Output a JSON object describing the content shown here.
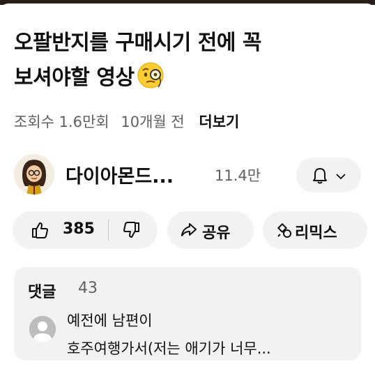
{
  "video": {
    "title_line1": "오팔반지를 구매시기 전에 꼭",
    "title_line2": "보셔야할 영상",
    "title_emoji": "monocle-face-emoji",
    "views": "조회수 1.6만회",
    "age": "10개월 전",
    "more_label": "더보기"
  },
  "channel": {
    "name": "다이아몬드...",
    "subscribers": "11.4만",
    "bell_icon": "bell-icon",
    "chevron_icon": "chevron-down-icon"
  },
  "actions": {
    "like_count": "385",
    "share_label": "공유",
    "remix_label": "리믹스"
  },
  "comments": {
    "heading": "댓글",
    "count": "43",
    "top_comment_line1": "예전에 남편이",
    "top_comment_line2": "호주여행가서(저는 애기가 너무..."
  },
  "colors": {
    "background": "#ffffff",
    "pill_background": "#f2f2f2",
    "secondary_text": "#606060"
  }
}
